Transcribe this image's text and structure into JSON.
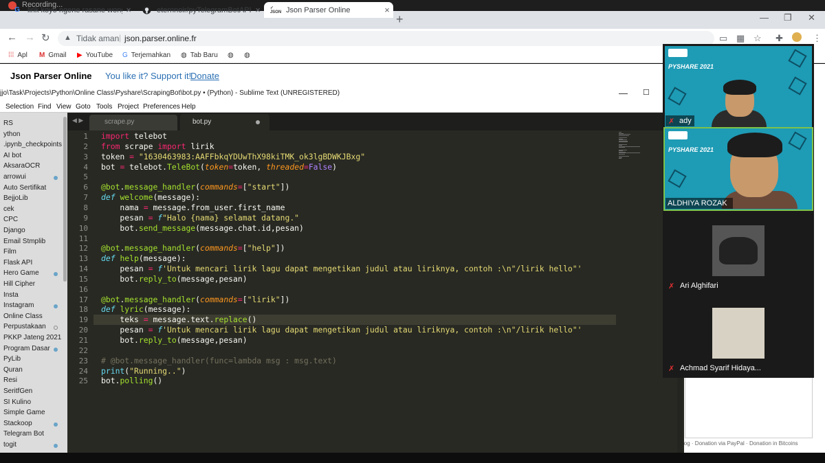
{
  "recorder": {
    "label": "Recording..."
  },
  "browser": {
    "tabs": [
      {
        "label": "lirik koyo ngene rasane wong ra",
        "favicon": "G"
      },
      {
        "label": "eternnoir/pyTelegramBotAPI: Py",
        "favicon": "github-icon"
      },
      {
        "label": "Json Parser Online",
        "favicon": "JSON"
      }
    ],
    "address": {
      "security": "Tidak aman",
      "url": "json.parser.online.fr"
    },
    "bookmarks": [
      {
        "label": "Apl",
        "icon": "apps-icon"
      },
      {
        "label": "Gmail",
        "icon": "gmail-icon"
      },
      {
        "label": "YouTube",
        "icon": "youtube-icon"
      },
      {
        "label": "Terjemahkan",
        "icon": "translate-icon"
      },
      {
        "label": "Tab Baru",
        "icon": "globe-icon"
      },
      {
        "label": "",
        "icon": "globe-icon"
      },
      {
        "label": "",
        "icon": "globe-icon"
      }
    ]
  },
  "site": {
    "title": "Json Parser Online",
    "support": "You like it? Support it!",
    "donate": "Donate"
  },
  "sublime": {
    "title": "jjo\\Task\\Projects\\Python\\Online Class\\Pyshare\\ScrapingBot\\bot.py • (Python) - Sublime Text (UNREGISTERED)",
    "menu": [
      "Selection",
      "Find",
      "View",
      "Goto",
      "Tools",
      "Project",
      "Preferences",
      "Help"
    ],
    "tabs": [
      {
        "label": "scrape.py"
      },
      {
        "label": "bot.py"
      }
    ],
    "sidebar": [
      {
        "label": "RS",
        "dot": ""
      },
      {
        "label": "ython",
        "dot": ""
      },
      {
        "label": ".ipynb_checkpoints",
        "dot": ""
      },
      {
        "label": "AI bot",
        "dot": ""
      },
      {
        "label": "AksaraOCR",
        "dot": ""
      },
      {
        "label": "arrowui",
        "dot": "filled"
      },
      {
        "label": "Auto Sertifikat",
        "dot": ""
      },
      {
        "label": "BejjoLib",
        "dot": ""
      },
      {
        "label": "cek",
        "dot": ""
      },
      {
        "label": "CPC",
        "dot": ""
      },
      {
        "label": "Django",
        "dot": ""
      },
      {
        "label": "Email Stmplib",
        "dot": ""
      },
      {
        "label": "Film",
        "dot": ""
      },
      {
        "label": "Flask API",
        "dot": ""
      },
      {
        "label": "Hero Game",
        "dot": "filled"
      },
      {
        "label": "Hill Cipher",
        "dot": ""
      },
      {
        "label": "Insta",
        "dot": ""
      },
      {
        "label": "Instagram",
        "dot": "filled"
      },
      {
        "label": "Online Class",
        "dot": ""
      },
      {
        "label": "Perpustakaan",
        "dot": "open"
      },
      {
        "label": "PKKP Jateng 2021",
        "dot": ""
      },
      {
        "label": "Program Dasar",
        "dot": "filled"
      },
      {
        "label": "PyLib",
        "dot": ""
      },
      {
        "label": "Quran",
        "dot": ""
      },
      {
        "label": "Resi",
        "dot": ""
      },
      {
        "label": "SeritfGen",
        "dot": ""
      },
      {
        "label": "SI Kulino",
        "dot": ""
      },
      {
        "label": "Simple Game",
        "dot": ""
      },
      {
        "label": "Stackoop",
        "dot": "filled"
      },
      {
        "label": "Telegram Bot",
        "dot": ""
      },
      {
        "label": "togit",
        "dot": "filled"
      }
    ],
    "code": [
      "import telebot",
      "from scrape import lirik",
      "token = \"1630463983:AAFFbkqYDUwThX98kiTMK_ok3lgBDWKJBxg\"",
      "bot = telebot.TeleBot(token=token, threaded=False)",
      "",
      "@bot.message_handler(commands=[\"start\"])",
      "def welcome(message):",
      "    nama = message.from_user.first_name",
      "    pesan = f\"Halo {nama} selamat datang.\"",
      "    bot.send_message(message.chat.id,pesan)",
      "",
      "@bot.message_handler(commands=[\"help\"])",
      "def help(message):",
      "    pesan = f'Untuk mencari lirik lagu dapat mengetikan judul atau liriknya, contoh :\\n\"/lirik hello\"'",
      "    bot.reply_to(message,pesan)",
      "",
      "@bot.message_handler(commands=[\"lirik\"])",
      "def lyric(message):",
      "    teks = message.text.replace()",
      "    pesan = f'Untuk mencari lirik lagu dapat mengetikan judul atau liriknya, contoh :\\n\"/lirik hello\"'",
      "    bot.reply_to(message,pesan)",
      "",
      "# @bot.message_handler(func=lambda msg : msg.text)",
      "print(\"Running..\")",
      "bot.polling()"
    ]
  },
  "participants": [
    {
      "name": "ady",
      "slide_title": "PYSHARE 2021",
      "muted": true
    },
    {
      "name": "ALDHIYA ROZAK",
      "slide_title": "PYSHARE 2021",
      "muted": false
    },
    {
      "name": "Ari Alghifari",
      "muted": true
    },
    {
      "name": "Achmad Syarif Hidaya...",
      "muted": true
    }
  ],
  "footer": {
    "links": "log · Donation via PayPal · Donation in Bitcoins"
  },
  "colors": {
    "editor_bg": "#282923",
    "keyword": "#f92672",
    "string": "#e6db74",
    "function": "#a6e22e",
    "builtin": "#66d9ef",
    "param": "#fd971f",
    "comment": "#75715e",
    "slide_bg": "#1e9bb5",
    "link": "#2a6fb3"
  }
}
